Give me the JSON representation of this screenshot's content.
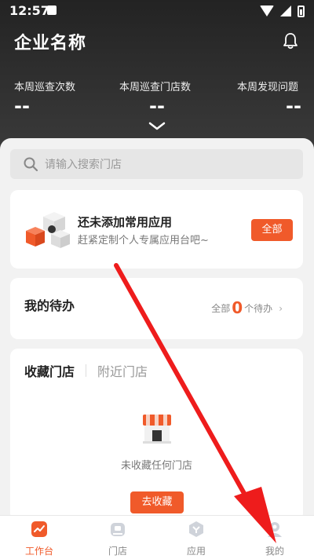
{
  "status_bar": {
    "time": "12:57"
  },
  "header": {
    "title": "企业名称",
    "stats": [
      {
        "label": "本周巡查次数",
        "value": "--"
      },
      {
        "label": "本周巡查门店数",
        "value": "--"
      },
      {
        "label": "本周发现问题",
        "value": "--"
      }
    ]
  },
  "search": {
    "placeholder": "请输入搜索门店"
  },
  "apps_card": {
    "title": "还未添加常用应用",
    "subtitle": "赶紧定制个人专属应用台吧~",
    "all_button": "全部"
  },
  "todo_card": {
    "title": "我的待办",
    "prefix": "全部",
    "count": "0",
    "suffix": "个待办"
  },
  "stores_card": {
    "tab_active": "收藏门店",
    "tab_inactive": "附近门店",
    "empty_text": "未收藏任何门店",
    "favorite_button": "去收藏"
  },
  "tabbar": {
    "items": [
      {
        "label": "工作台",
        "icon": "workbench-icon"
      },
      {
        "label": "门店",
        "icon": "store-icon"
      },
      {
        "label": "应用",
        "icon": "apps-icon"
      },
      {
        "label": "我的",
        "icon": "profile-icon"
      }
    ]
  },
  "colors": {
    "accent": "#f05a2a",
    "header_bg": "#2b2b2b",
    "annotation_arrow": "#ee1c1c"
  }
}
